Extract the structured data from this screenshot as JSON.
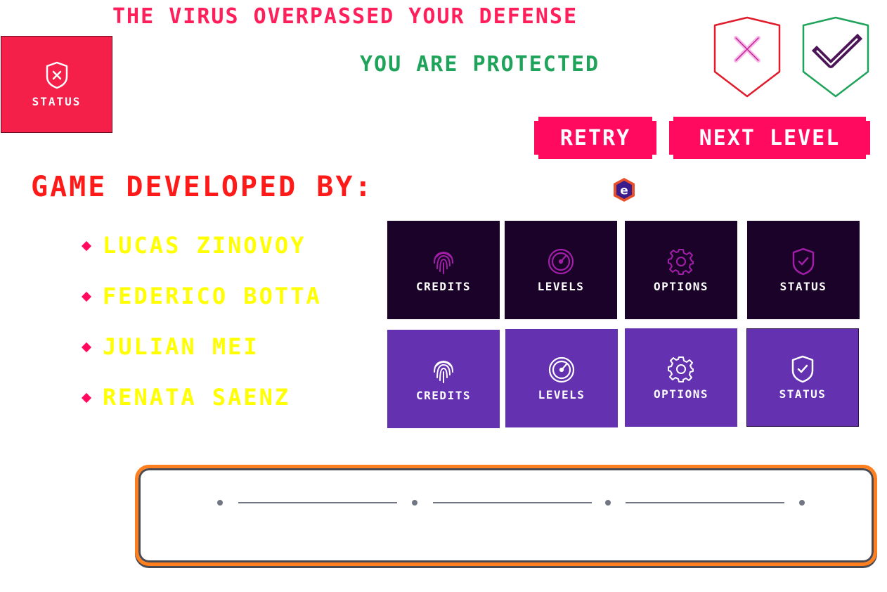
{
  "messages": {
    "fail": "THE VIRUS OVERPASSED YOUR DEFENSE",
    "success": "YOU ARE PROTECTED"
  },
  "status_card": {
    "label": "STATUS",
    "icon": "shield-x-icon"
  },
  "buttons": {
    "retry": "RETRY",
    "next": "NEXT LEVEL"
  },
  "developers": {
    "heading": "GAME DEVELOPED BY:",
    "names": [
      "LUCAS ZINOVOY",
      "FEDERICO BOTTA",
      "JULIAN MEI",
      "RENATA SAENZ"
    ]
  },
  "logo": {
    "letter": "e"
  },
  "menu_tiles": {
    "dark": [
      {
        "label": "CREDITS",
        "icon": "fingerprint-icon"
      },
      {
        "label": "LEVELS",
        "icon": "gauge-icon"
      },
      {
        "label": "OPTIONS",
        "icon": "gear-icon"
      },
      {
        "label": "STATUS",
        "icon": "shield-check-icon"
      }
    ],
    "light": [
      {
        "label": "CREDITS",
        "icon": "fingerprint-icon"
      },
      {
        "label": "LEVELS",
        "icon": "gauge-icon"
      },
      {
        "label": "OPTIONS",
        "icon": "gear-icon"
      },
      {
        "label": "STATUS",
        "icon": "shield-check-icon"
      }
    ]
  },
  "colors": {
    "accent": "#ff0a5e",
    "fail_text": "#ff1f5a",
    "success_text": "#1fa35a",
    "heading": "#ff1a1a",
    "names": "#ffff00",
    "tile_dark": "#1b0228",
    "tile_light": "#6432b0",
    "stepper_border": "#ff7f1e"
  },
  "stepper": {
    "steps": 4
  }
}
